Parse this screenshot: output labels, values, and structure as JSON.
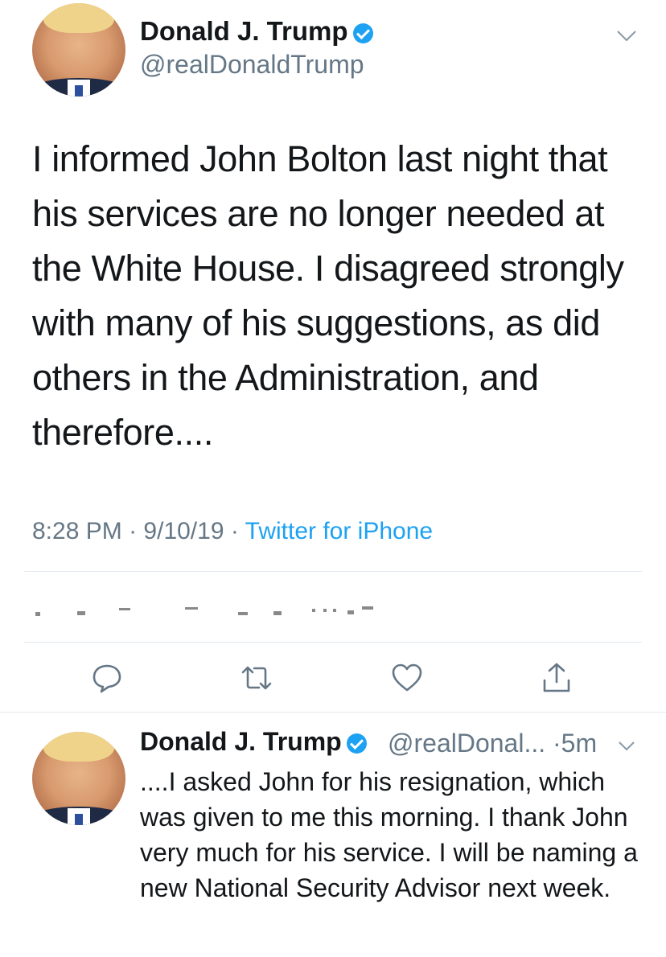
{
  "tweet": {
    "display_name": "Donald J. Trump",
    "handle": "@realDonaldTrump",
    "text": "I informed John Bolton last night that his services are no longer needed at the White House. I disagreed strongly with many of his suggestions, as did others in the Administration, and therefore....",
    "time": "8:28 PM",
    "date": "9/10/19",
    "sep": "·",
    "source": "Twitter for iPhone",
    "icons": {
      "verified": "verified-badge-icon",
      "menu": "chevron-down-icon"
    }
  },
  "actions": [
    {
      "name": "reply",
      "icon": "reply-icon"
    },
    {
      "name": "retweet",
      "icon": "retweet-icon"
    },
    {
      "name": "like",
      "icon": "heart-icon"
    },
    {
      "name": "share",
      "icon": "share-icon"
    }
  ],
  "reply_tweet": {
    "display_name": "Donald J. Trump",
    "handle": "@realDonal...",
    "sep": "·",
    "age": "5m",
    "text": "....I asked John for his resignation, which was given to me this morning. I thank John very much for his service. I will be naming a new National Security Advisor next week."
  },
  "colors": {
    "accent": "#1da1f2",
    "text": "#14171a",
    "secondary": "#657786",
    "divider": "#e1e8ed"
  }
}
